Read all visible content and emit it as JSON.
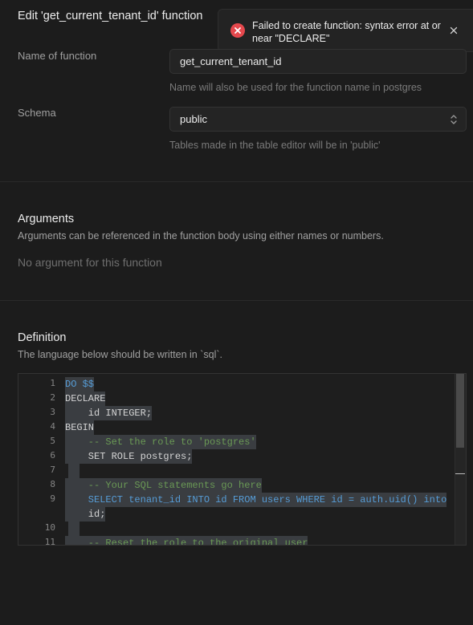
{
  "panel": {
    "title": "Edit 'get_current_tenant_id' function"
  },
  "toast": {
    "message": "Failed to create function: syntax error at or near \"DECLARE\"",
    "type": "error",
    "icon": "error-x-icon",
    "close_icon": "close-icon"
  },
  "fields": {
    "name": {
      "label": "Name of function",
      "value": "get_current_tenant_id",
      "hint": "Name will also be used for the function name in postgres"
    },
    "schema": {
      "label": "Schema",
      "value": "public",
      "hint": "Tables made in the table editor will be in 'public'"
    }
  },
  "arguments": {
    "title": "Arguments",
    "description": "Arguments can be referenced in the function body using either names or numbers.",
    "empty": "No argument for this function"
  },
  "definition": {
    "title": "Definition",
    "description": "The language below should be written in `sql`.",
    "line_numbers": [
      "1",
      "2",
      "3",
      "4",
      "5",
      "6",
      "7",
      "8",
      "9",
      "",
      "10",
      "11"
    ],
    "lines": [
      "DO $$",
      "DECLARE",
      "    id INTEGER;",
      "BEGIN",
      "    -- Set the role to 'postgres'",
      "    SET ROLE postgres;",
      "",
      "    -- Your SQL statements go here",
      "    SELECT tenant_id INTO id FROM users WHERE id = auth.uid() into",
      "    id;",
      "",
      "    -- Reset the role to the original user"
    ]
  },
  "colors": {
    "background": "#1c1c1c",
    "error": "#e5484d",
    "keyword": "#569cd6",
    "comment": "#6a9955",
    "selection": "#3a3d41"
  }
}
